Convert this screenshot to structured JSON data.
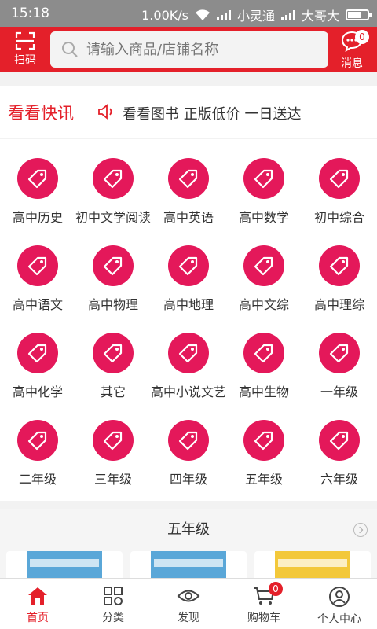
{
  "status_bar": {
    "time": "15:18",
    "speed": "1.00K/s",
    "carrier1": "小灵通",
    "carrier2": "大哥大",
    "net": "4G"
  },
  "header": {
    "scan_label": "扫码",
    "search_placeholder": "请输入商品/店铺名称",
    "message_label": "消息",
    "message_count": "0",
    "accent_color": "#e4202a"
  },
  "news": {
    "title": "看看快讯",
    "text": "看看图书 正版低价 一日送达"
  },
  "categories": [
    {
      "label": "高中历史"
    },
    {
      "label": "初中文学阅读"
    },
    {
      "label": "高中英语"
    },
    {
      "label": "高中数学"
    },
    {
      "label": "初中综合"
    },
    {
      "label": "高中语文"
    },
    {
      "label": "高中物理"
    },
    {
      "label": "高中地理"
    },
    {
      "label": "高中文综"
    },
    {
      "label": "高中理综"
    },
    {
      "label": "高中化学"
    },
    {
      "label": "其它"
    },
    {
      "label": "高中小说文艺"
    },
    {
      "label": "高中生物"
    },
    {
      "label": "一年级"
    },
    {
      "label": "二年级"
    },
    {
      "label": "三年级"
    },
    {
      "label": "四年级"
    },
    {
      "label": "五年级"
    },
    {
      "label": "六年级"
    }
  ],
  "section": {
    "title": "五年级"
  },
  "bottom_nav": {
    "items": [
      {
        "label": "首页",
        "icon": "home-icon"
      },
      {
        "label": "分类",
        "icon": "grid-icon"
      },
      {
        "label": "发现",
        "icon": "eye-icon"
      },
      {
        "label": "购物车",
        "icon": "cart-icon"
      },
      {
        "label": "个人中心",
        "icon": "user-icon"
      }
    ],
    "cart_count": "0"
  }
}
